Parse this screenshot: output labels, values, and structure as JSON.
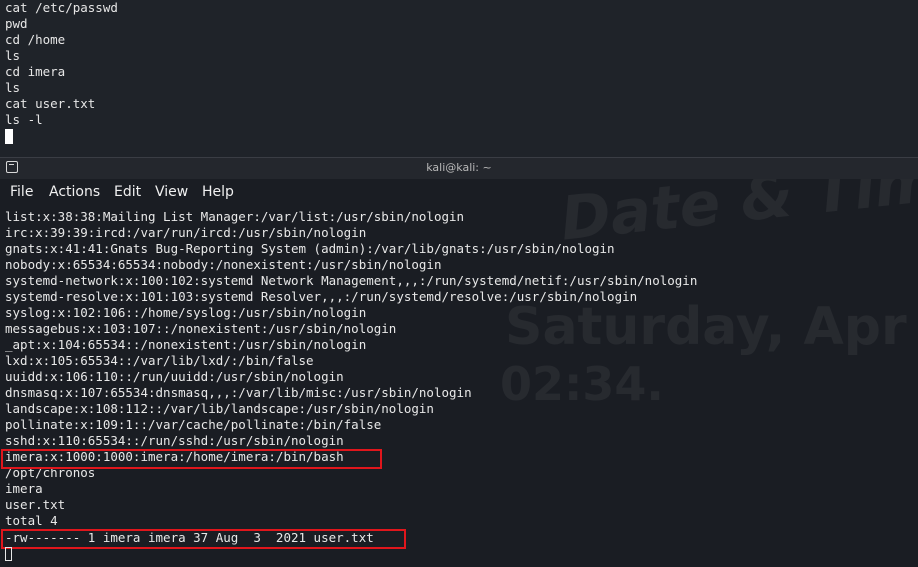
{
  "history": {
    "lines": [
      "cat /etc/passwd",
      "pwd",
      "cd /home",
      "ls",
      "cd imera",
      "ls",
      "cat user.txt",
      "ls -l"
    ]
  },
  "window": {
    "title": "kali@kali: ~"
  },
  "menu": {
    "file": "File",
    "actions": "Actions",
    "edit": "Edit",
    "view": "View",
    "help": "Help"
  },
  "wallpaper": {
    "line1": "Date & Tim",
    "line2": "Saturday, Apr",
    "line3": "02:34."
  },
  "terminal": {
    "lines": [
      "list:x:38:38:Mailing List Manager:/var/list:/usr/sbin/nologin",
      "irc:x:39:39:ircd:/var/run/ircd:/usr/sbin/nologin",
      "gnats:x:41:41:Gnats Bug-Reporting System (admin):/var/lib/gnats:/usr/sbin/nologin",
      "nobody:x:65534:65534:nobody:/nonexistent:/usr/sbin/nologin",
      "systemd-network:x:100:102:systemd Network Management,,,:/run/systemd/netif:/usr/sbin/nologin",
      "systemd-resolve:x:101:103:systemd Resolver,,,:/run/systemd/resolve:/usr/sbin/nologin",
      "syslog:x:102:106::/home/syslog:/usr/sbin/nologin",
      "messagebus:x:103:107::/nonexistent:/usr/sbin/nologin",
      "_apt:x:104:65534::/nonexistent:/usr/sbin/nologin",
      "lxd:x:105:65534::/var/lib/lxd/:/bin/false",
      "uuidd:x:106:110::/run/uuidd:/usr/sbin/nologin",
      "dnsmasq:x:107:65534:dnsmasq,,,:/var/lib/misc:/usr/sbin/nologin",
      "landscape:x:108:112::/var/lib/landscape:/usr/sbin/nologin",
      "pollinate:x:109:1::/var/cache/pollinate:/bin/false",
      "sshd:x:110:65534::/run/sshd:/usr/sbin/nologin",
      "imera:x:1000:1000:imera:/home/imera:/bin/bash",
      "/opt/chronos",
      "imera",
      "user.txt",
      "total 4",
      "-rw------- 1 imera imera 37 Aug  3  2021 user.txt"
    ]
  },
  "highlight_color": "#e0161c"
}
